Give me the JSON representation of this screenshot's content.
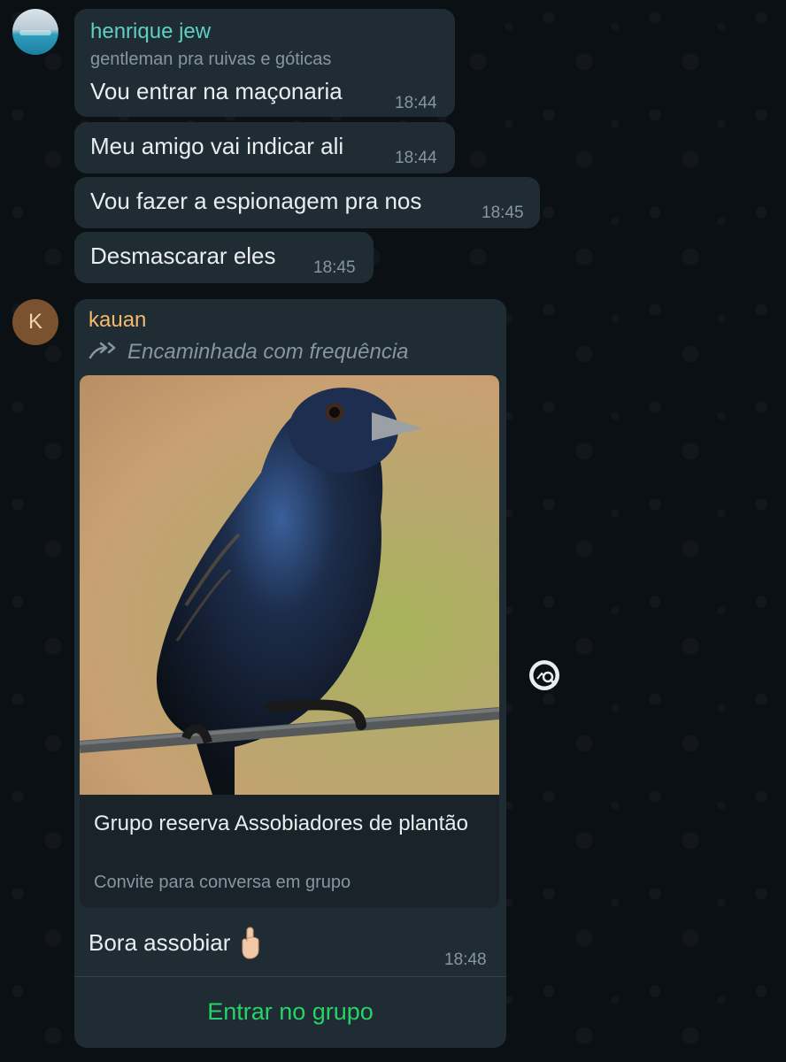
{
  "messages": [
    {
      "sender": "henrique jew",
      "sender_subtitle": "gentleman pra ruivas e góticas",
      "text": "Vou entrar na maçonaria",
      "time": "18:44"
    },
    {
      "text": "Meu amigo vai indicar ali",
      "time": "18:44"
    },
    {
      "text": "Vou fazer a espionagem pra nos",
      "time": "18:45"
    },
    {
      "text": "Desmascarar eles",
      "time": "18:45"
    }
  ],
  "invite_message": {
    "avatar_letter": "K",
    "sender": "kauan",
    "forwarded_label": "Encaminhada com frequência",
    "card_title": "Grupo reserva Assobiadores de plantão",
    "card_subtitle": "Convite para conversa em grupo",
    "text": "Bora assobiar",
    "emoji": "👆🏼",
    "time": "18:48",
    "join_button": "Entrar no grupo"
  },
  "icons": {
    "forward": "forward-arrows-icon",
    "search_image": "search-image-icon",
    "pointing_hand": "pointing-up-hand-icon"
  },
  "colors": {
    "background": "#0b1014",
    "bubble": "#202c33",
    "henrique_name": "#5fcfc3",
    "kauan_name": "#f4b96a",
    "join_green": "#25d366",
    "secondary_text": "#8696a0"
  }
}
